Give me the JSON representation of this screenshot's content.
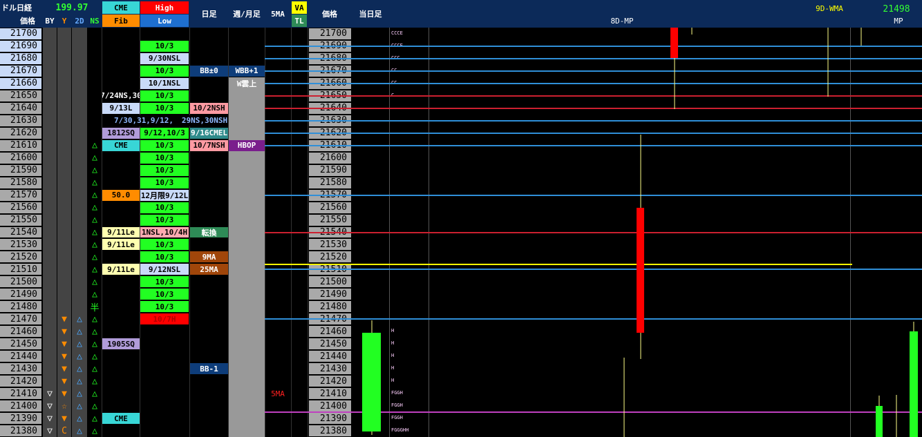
{
  "header": {
    "title": "ドル日経",
    "price": "199.97",
    "price_hdr": "価格",
    "col_by": "BY",
    "col_y": "Y",
    "col_2d": "2D",
    "col_ns": "NS",
    "cme": "CME",
    "fib": "Fib",
    "high": "High",
    "low": "Low",
    "daily": "日足",
    "weekly": "週/月足",
    "ma5": "5MA",
    "va": "VA",
    "tl": "TL",
    "price_hdr2": "価格",
    "today": "当日足",
    "mp8": "8D-MP",
    "wma9": "9D-WMA",
    "wma_val": "21498",
    "mp": "MP"
  },
  "colors": {
    "header_bg": "#0c2a59",
    "green": "#22ff22",
    "red": "#ff0000",
    "blue_line": "#2f8fd8",
    "red_line": "#cc2030",
    "yellow_line": "#ffff00",
    "magenta_line": "#c040c0",
    "price_col": "#a9a9a9",
    "price_col_hi": "#c9daf8"
  },
  "prices": [
    "21700",
    "21690",
    "21680",
    "21670",
    "21660",
    "21650",
    "21640",
    "21630",
    "21620",
    "21610",
    "21600",
    "21590",
    "21580",
    "21570",
    "21560",
    "21550",
    "21540",
    "21530",
    "21520",
    "21510",
    "21500",
    "21490",
    "21480",
    "21470",
    "21460",
    "21450",
    "21440",
    "21430",
    "21420",
    "21410",
    "21400",
    "21390",
    "21380"
  ],
  "by_marks": [
    "",
    "",
    "",
    "",
    "",
    "",
    "",
    "",
    "",
    "",
    "",
    "",
    "",
    "",
    "",
    "",
    "",
    "",
    "",
    "",
    "",
    "",
    "",
    "",
    "",
    "",
    "",
    "",
    "",
    "▽",
    "▽",
    "▽",
    "▽"
  ],
  "y_marks": [
    "",
    "",
    "",
    "",
    "",
    "",
    "",
    "",
    "",
    "",
    "",
    "",
    "",
    "",
    "",
    "",
    "",
    "",
    "",
    "",
    "",
    "",
    "",
    "▼",
    "▼",
    "▼",
    "▼",
    "▼",
    "▼",
    "▼",
    "☆",
    "▼",
    "C"
  ],
  "d2_marks": [
    "",
    "",
    "",
    "",
    "",
    "",
    "",
    "",
    "",
    "",
    "",
    "",
    "",
    "",
    "",
    "",
    "",
    "",
    "",
    "",
    "",
    "",
    "",
    "△",
    "△",
    "△",
    "△",
    "△",
    "△",
    "△",
    "△",
    "△",
    "△"
  ],
  "ns_marks": [
    "",
    "",
    "",
    "",
    "",
    "",
    "",
    "",
    "",
    "△",
    "△",
    "△",
    "△",
    "△",
    "△",
    "△",
    "△",
    "△",
    "△",
    "△",
    "△",
    "△",
    "半",
    "△",
    "△",
    "△",
    "△",
    "△",
    "△",
    "△",
    "△",
    "△",
    "△"
  ],
  "fib_labels": [
    {
      "row": 5,
      "text": "7/24NS,30"
    },
    {
      "row": 6,
      "text": "9/13L"
    },
    {
      "row": 7,
      "text": "7/30,31,9/12,"
    },
    {
      "row": 8,
      "text": "1812SQ"
    },
    {
      "row": 9,
      "text": "CME"
    },
    {
      "row": 13,
      "text": "50.0"
    },
    {
      "row": 16,
      "text": "9/11Le"
    },
    {
      "row": 17,
      "text": "9/11Le"
    },
    {
      "row": 19,
      "text": "9/11Le"
    },
    {
      "row": 25,
      "text": "1905SQ"
    },
    {
      "row": 31,
      "text": "CME"
    }
  ],
  "hl_labels": [
    {
      "row": 1,
      "text": "10/3"
    },
    {
      "row": 2,
      "text": "9/30NSL"
    },
    {
      "row": 3,
      "text": "10/3"
    },
    {
      "row": 4,
      "text": "10/1NSL"
    },
    {
      "row": 5,
      "text": "10/3"
    },
    {
      "row": 6,
      "text": "10/3"
    },
    {
      "row": 7,
      "text": ""
    },
    {
      "row": 8,
      "text": "9/12,10/3"
    },
    {
      "row": 9,
      "text": "10/3"
    },
    {
      "row": 10,
      "text": "10/3"
    },
    {
      "row": 11,
      "text": "10/3"
    },
    {
      "row": 12,
      "text": "10/3"
    },
    {
      "row": 13,
      "text": "12月限9/12L"
    },
    {
      "row": 14,
      "text": "10/3"
    },
    {
      "row": 15,
      "text": "10/3"
    },
    {
      "row": 16,
      "text": "1NSL,10/4H"
    },
    {
      "row": 17,
      "text": "10/3"
    },
    {
      "row": 18,
      "text": "10/3"
    },
    {
      "row": 19,
      "text": "9/12NSL"
    },
    {
      "row": 20,
      "text": "10/3"
    },
    {
      "row": 21,
      "text": "10/3"
    },
    {
      "row": 22,
      "text": "10/3"
    },
    {
      "row": 23,
      "text": "10/7H"
    }
  ],
  "daily_labels": [
    {
      "row": 3,
      "text": "BB±0"
    },
    {
      "row": 6,
      "text": "10/2NSH"
    },
    {
      "row": 7,
      "text": "29NS,30NSH"
    },
    {
      "row": 8,
      "text": "9/16CMEL"
    },
    {
      "row": 9,
      "text": "10/7NSH"
    },
    {
      "row": 16,
      "text": "転換"
    },
    {
      "row": 18,
      "text": "9MA"
    },
    {
      "row": 19,
      "text": "25MA"
    },
    {
      "row": 27,
      "text": "BB-1"
    }
  ],
  "weekly_labels": [
    {
      "row": 3,
      "text": "WBB+1"
    },
    {
      "row": 4,
      "text": "W雲上"
    },
    {
      "row": 9,
      "text": "HBOP"
    }
  ],
  "ma5_label": {
    "row": 29,
    "text": "5MA"
  },
  "mp_letters": [
    {
      "row": 0,
      "text": "CCCE"
    },
    {
      "row": 1,
      "text": "CCCE"
    },
    {
      "row": 2,
      "text": "CCC"
    },
    {
      "row": 3,
      "text": "CC"
    },
    {
      "row": 4,
      "text": "CC"
    },
    {
      "row": 5,
      "text": "C"
    },
    {
      "row": 24,
      "text": "H"
    },
    {
      "row": 25,
      "text": "H"
    },
    {
      "row": 26,
      "text": "H"
    },
    {
      "row": 27,
      "text": "H"
    },
    {
      "row": 28,
      "text": "H"
    },
    {
      "row": 29,
      "text": "FGGH"
    },
    {
      "row": 30,
      "text": "FGGH"
    },
    {
      "row": 31,
      "text": "FGGH"
    },
    {
      "row": 32,
      "text": "FGGGHH"
    }
  ]
}
